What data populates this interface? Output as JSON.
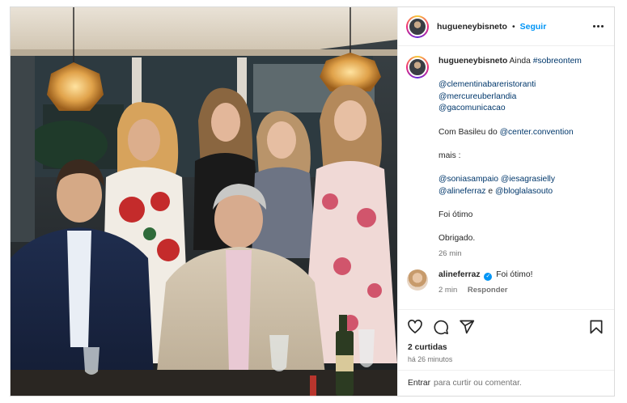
{
  "post": {
    "author": "hugueneybisneto",
    "separator": "•",
    "follow_label": "Seguir",
    "photo_alt": "Grupo de pessoas sentadas e em pé em um restaurante"
  },
  "caption": {
    "author": "hugueneybisneto",
    "text_prefix": "Ainda",
    "hashtag": "#sobreontem",
    "mentions_block": [
      "@clementinabareristoranti",
      "@mercureuberlandia",
      "@gacomunicacao"
    ],
    "basileu_prefix": "Com Basileu do",
    "basileu_tag": "@center.convention",
    "mais": "mais :",
    "more_line1_a": "@soniasampaio",
    "more_line1_b": "@iesagrasielly",
    "more_line2_a": "@alineferraz",
    "more_line2_and": "e",
    "more_line2_b": "@bloglalasouto",
    "line_foi": "Foi ótimo",
    "line_obrigado": "Obrigado.",
    "time": "26 min"
  },
  "comment": {
    "author": "alineferraz",
    "verified_glyph": "✓",
    "text": "Foi ótimo!",
    "time": "2 min",
    "reply_label": "Responder"
  },
  "stats": {
    "likes": "2 curtidas",
    "posted": "há 26 minutos"
  },
  "footer": {
    "login_link": "Entrar",
    "login_rest": "para curtir ou comentar."
  },
  "icons": [
    "heart-icon",
    "comment-icon",
    "share-icon",
    "bookmark-icon",
    "more-options-icon"
  ],
  "colors": {
    "accent": "#0095f6",
    "link": "#00376b",
    "muted": "#737373",
    "text": "#262626"
  }
}
